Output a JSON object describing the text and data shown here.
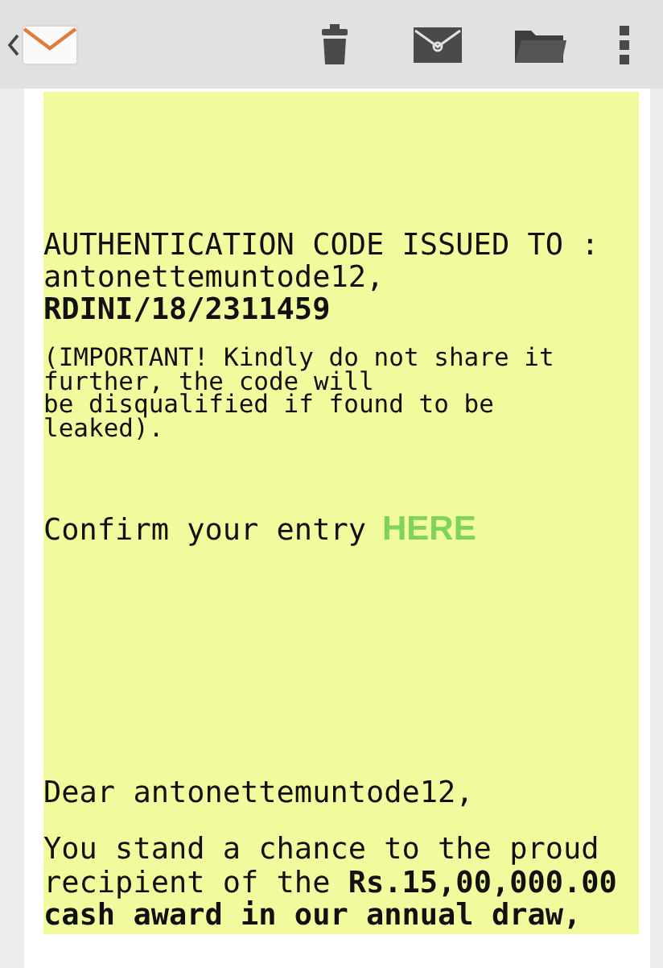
{
  "email": {
    "heading": "AUTHENTICATION CODE ISSUED TO :",
    "recipient": "antonettemuntode12,",
    "code": "RDINI/18/2311459",
    "notice": [
      "(IMPORTANT! Kindly do not share it",
      "further, the code will",
      "be disqualified if found to be",
      "leaked)."
    ],
    "confirm_text": "Confirm your entry",
    "confirm_link": "HERE",
    "greeting": "Dear antonettemuntode12,",
    "body": "You stand a chance to the proud recipient of the **Rs.15,00,000.00 cash award in our annual draw,**"
  }
}
